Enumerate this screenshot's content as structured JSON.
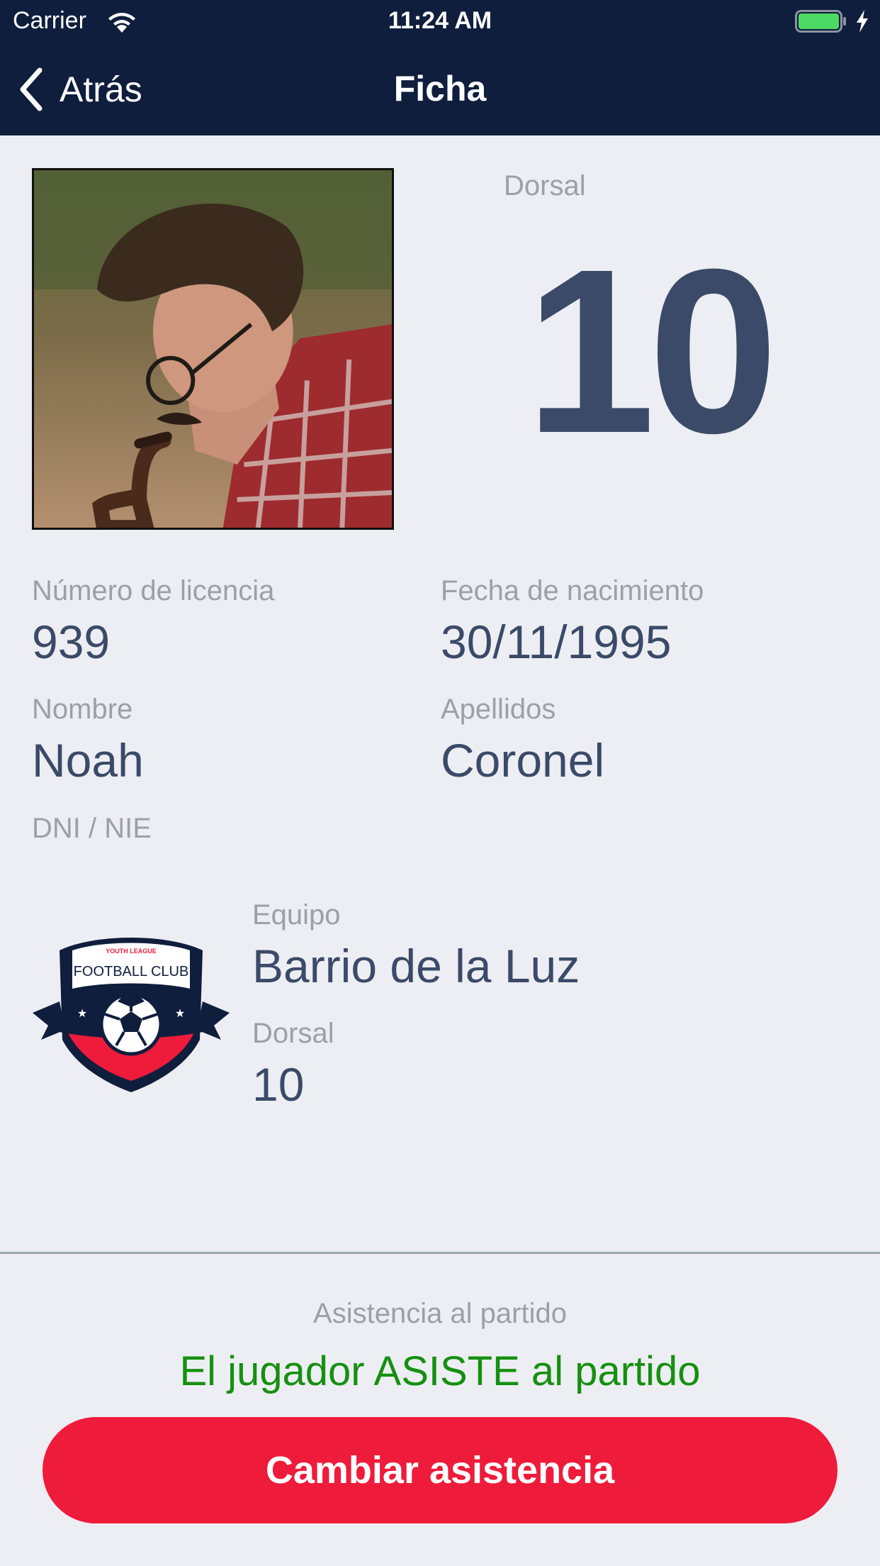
{
  "status_bar": {
    "carrier": "Carrier",
    "time": "11:24 AM",
    "battery_color": "#4cd964"
  },
  "nav": {
    "back_label": "Atrás",
    "title": "Ficha",
    "background": "#0f1e3c"
  },
  "player": {
    "photo_alt": "player photo",
    "dorsal_label": "Dorsal",
    "dorsal_number": "10",
    "license_label": "Número de licencia",
    "license_value": "939",
    "birthdate_label": "Fecha de nacimiento",
    "birthdate_value": "30/11/1995",
    "name_label": "Nombre",
    "name_value": "Noah",
    "surname_label": "Apellidos",
    "surname_value": "Coronel",
    "dni_label": "DNI / NIE"
  },
  "team": {
    "crest_top_text": "YOUTH LEAGUE",
    "crest_text": "FOOTBALL CLUB",
    "team_label": "Equipo",
    "team_value": "Barrio de la Luz",
    "dorsal_label": "Dorsal",
    "dorsal_value": "10"
  },
  "attendance": {
    "label": "Asistencia al partido",
    "status": "El jugador ASISTE al partido",
    "status_color": "#15900f",
    "button_label": "Cambiar asistencia",
    "button_color": "#ef1b3a"
  }
}
